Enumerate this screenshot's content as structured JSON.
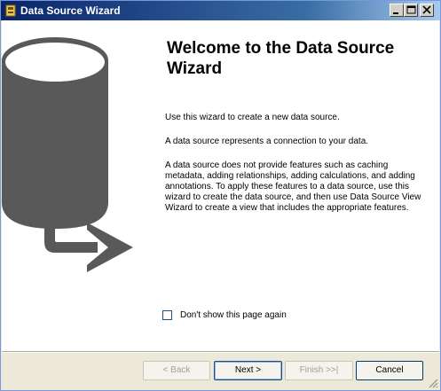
{
  "window": {
    "title": "Data Source Wizard"
  },
  "titlebar_buttons": {
    "minimize_icon": "minimize-icon",
    "maximize_icon": "maximize-icon",
    "close_icon": "close-icon"
  },
  "page": {
    "heading": "Welcome to the Data Source Wizard",
    "paragraph1": "Use this wizard to create a new data source.",
    "paragraph2": "A data source represents a connection to your data.",
    "paragraph3": "A data source does not provide features such as caching metadata, adding relationships, adding calculations, and adding annotations. To apply these features to a data source, use this wizard to create the data source, and then use Data Source View Wizard to create a view that includes the appropriate features.",
    "checkbox_label": "Don't show this page again",
    "checkbox_checked": false
  },
  "buttons": {
    "back": "< Back",
    "next": "Next >",
    "finish": "Finish >>|",
    "cancel": "Cancel"
  },
  "colors": {
    "graphic_gray": "#595959",
    "titlebar_start": "#0a246a",
    "titlebar_end": "#a6caf0"
  }
}
